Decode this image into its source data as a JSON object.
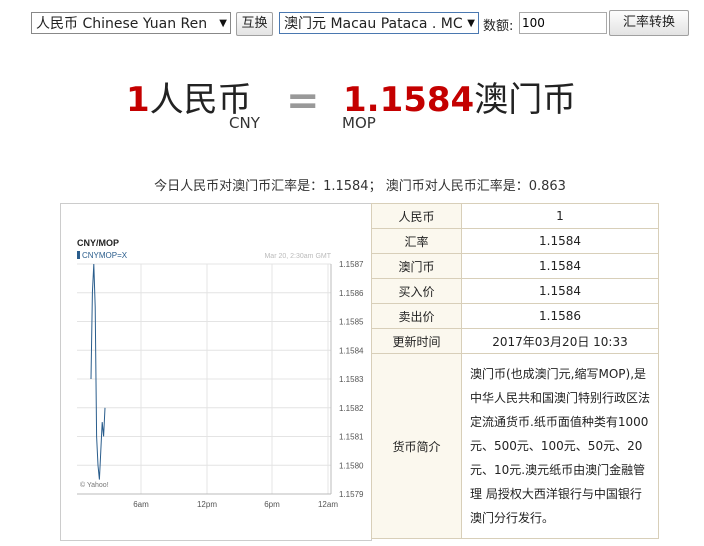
{
  "controls": {
    "from_currency": "人民币 Chinese Yuan Ren",
    "swap_label": "互换",
    "to_currency": "澳门元 Macau Pataca . MC",
    "amount_label": "数额:",
    "amount_value": "100",
    "convert_label": "汇率转换"
  },
  "result": {
    "from_amount": "1",
    "from_name": "人民币",
    "from_code": "CNY",
    "equals": "=",
    "to_amount": "1.1584",
    "to_name": "澳门币",
    "to_code": "MOP"
  },
  "summary": "今日人民币对澳门币汇率是：1.1584； 澳门币对人民币汇率是：0.863",
  "table": {
    "rows": [
      {
        "label": "人民币",
        "value": "1"
      },
      {
        "label": "汇率",
        "value": "1.1584"
      },
      {
        "label": "澳门币",
        "value": "1.1584"
      },
      {
        "label": "买入价",
        "value": "1.1584"
      },
      {
        "label": "卖出价",
        "value": "1.1586"
      },
      {
        "label": "更新时间",
        "value": "2017年03月20日 10:33"
      }
    ],
    "desc_label": "货币简介",
    "desc_text": "澳门币(也成澳门元,缩写MOP),是中华人民共和国澳门特别行政区法定流通货币.纸币面值种类有1000元、500元、100元、50元、20元、10元.澳元纸币由澳门金融管理 局授权大西洋银行与中国银行澳门分行发行。"
  },
  "chart_data": {
    "type": "line",
    "title": "CNY/MOP",
    "series": [
      {
        "name": "CNYMOP=X",
        "values": [
          1.1583,
          1.1586,
          1.1587,
          1.15855,
          1.1581,
          1.158,
          1.15795,
          1.15805,
          1.15815,
          1.1581,
          1.1582
        ]
      }
    ],
    "timestamp": "Mar 20, 2:30am GMT",
    "xticks": [
      "6am",
      "12pm",
      "6pm",
      "12am"
    ],
    "yticks": [
      1.1587,
      1.1586,
      1.1585,
      1.1584,
      1.1583,
      1.1582,
      1.1581,
      1.158,
      1.1579
    ],
    "ylim": [
      1.1579,
      1.1587
    ],
    "watermark": "© Yahoo!",
    "line_color": "#2a5d8c"
  }
}
